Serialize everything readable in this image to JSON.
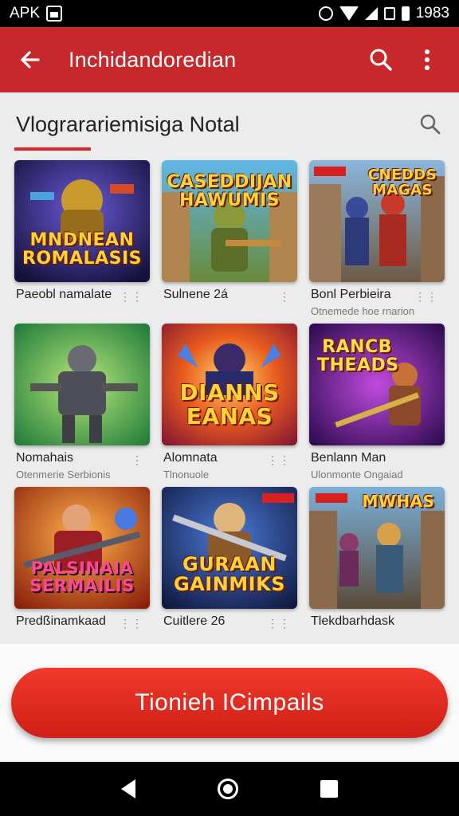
{
  "status_bar": {
    "app_label": "APK",
    "time": "1983"
  },
  "app_bar": {
    "title": "Inchidandoredian"
  },
  "section": {
    "title": "Vlograrariemisiga Notal"
  },
  "colors": {
    "accent": "#c7282c",
    "cta": "#e0291f"
  },
  "games": [
    {
      "name": "Paeobl namalate",
      "subtitle": "",
      "logo": "MNDNEAN ROMALASIS",
      "more": "⋮⋮"
    },
    {
      "name": "Sulnene 2á",
      "subtitle": "",
      "logo": "CASEDDIJAN HAWUMIS",
      "more": "⋮"
    },
    {
      "name": "Bonl Perbieira",
      "subtitle": "Otnemede hoe rnarion",
      "logo": "CNEDDS MAGAS",
      "more": "⋮⋮"
    },
    {
      "name": "Nomahais",
      "subtitle": "Otenmerie Serbionis",
      "logo": "",
      "more": "⋮"
    },
    {
      "name": "Alomnata",
      "subtitle": "Tlnonuole",
      "logo": "DIANNS EANAS",
      "more": "⋮⋮"
    },
    {
      "name": "Benlann Man",
      "subtitle": "Ulonmonte Ongaiad",
      "logo": "RANCB THEADS",
      "more": ""
    },
    {
      "name": "Predßinamkaad",
      "subtitle": "",
      "logo": "PALSINAIA SERMAILIS",
      "more": "⋮⋮"
    },
    {
      "name": "Cuitlere 26",
      "subtitle": "",
      "logo": "GURAAN GAINMIKS",
      "more": "⋮⋮"
    },
    {
      "name": "Tlekdbarhdask",
      "subtitle": "",
      "logo": "MWHAS",
      "more": ""
    }
  ],
  "cta": {
    "label": "Tionieh ICimpails"
  }
}
